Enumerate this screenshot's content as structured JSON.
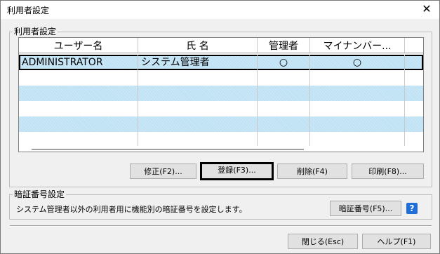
{
  "window": {
    "title": "利用者設定",
    "close_glyph": "✕"
  },
  "user_group": {
    "legend": "利用者設定",
    "columns": [
      "ユーザー名",
      "氏 名",
      "管理者",
      "マイナンバー..."
    ],
    "rows": [
      {
        "user": "ADMINISTRATOR",
        "name": "システム管理者",
        "admin": "○",
        "mynumber": "○"
      }
    ],
    "buttons": {
      "edit": "修正(F2)...",
      "register": "登録(F3)...",
      "delete": "削除(F4)",
      "print": "印刷(F8)..."
    }
  },
  "pin_group": {
    "legend": "暗証番号設定",
    "description": "システム管理者以外の利用者用に機能別の暗証番号を設定します。",
    "button": "暗証番号(F5)...",
    "help_glyph": "?"
  },
  "footer": {
    "close": "閉じる(Esc)",
    "help": "ヘルプ(F1)"
  }
}
